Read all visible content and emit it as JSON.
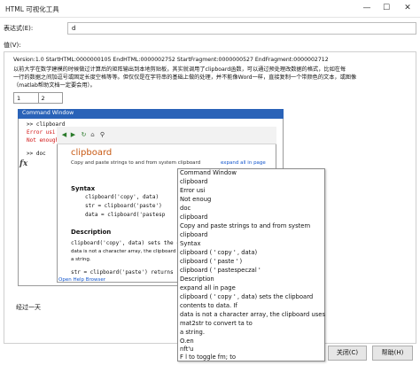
{
  "window": {
    "title": "HTML 可视化工具",
    "minimize": "—",
    "maximize": "☐",
    "close": "✕"
  },
  "expression": {
    "label": "表达式(E):",
    "value": "d"
  },
  "value": {
    "label": "值(V):"
  },
  "clipboard_content": {
    "header_line": "Version:1.0 StartHTML:0000000105 EndHTML:0000002752 StartFragment:0000000527 EndFragment:0000002712",
    "paragraph": [
      "以前大学在数学建模的时候做过计算后的矩阵输出到本地剪贴板，其实就调用了clipboard函数，可以通过预处理改数据的格式，比如在每",
      "一行的数据之间加逗号或固定长度空格等等。但仅仅是在字符串的基础上做的处理，并不能像Word一样，直接复制一个带颜色的文本，或图像",
      "（matlab帮助文档一定要会用）。"
    ],
    "table": [
      "1",
      "2"
    ],
    "matlab_window_title": "Command Window",
    "code_lines": [
      ">> clipboard",
      "Error usi",
      "Not enough",
      ">> doc"
    ],
    "fx": "fx"
  },
  "help_browser": {
    "toolbar_icons": [
      "back-arrow-icon",
      "forward-arrow-icon",
      "refresh-icon",
      "home-icon",
      "find-icon"
    ],
    "page_title": "clipboard",
    "page_desc": "Copy and paste strings to and from system clipboard",
    "expand_link": "expand all in page",
    "syntax_heading": "Syntax",
    "syntax_lines": [
      "clipboard('copy', data)",
      "str = clipboard('paste')",
      "data = clipboard('pastesp"
    ],
    "description_heading": "Description",
    "description_lines": [
      "clipboard('copy', data) sets the clip",
      "data is not a character array, the clipboard us",
      "a string.",
      "str = clipboard('paste') returns"
    ],
    "open_help": "Open Help Browser"
  },
  "context_menu": {
    "items": [
      "Command Window",
      "clipboard",
      "Error usi",
      "Not enoug",
      "doc",
      "clipboard",
      "Copy and paste strings to and from system",
      "clipboard",
      "Syntax",
      "clipboard ( ' copy ' , data)",
      "clipboard ( ' paste ' )",
      "clipboard ( ' pastespeczal ' ",
      "Description",
      "expand all in page",
      "clipboard ( ' copy ' , data) sets the clipboard",
      "contents to data. If",
      "data is not a character array, the clipboard uses",
      "mat2str to convert ta to",
      "a string.",
      "O.en",
      "nft'u",
      "F l to toggle fm; to"
    ]
  },
  "footer_text": "经过一天",
  "buttons": {
    "close": "关闭(C)",
    "help": "帮助(H)"
  }
}
